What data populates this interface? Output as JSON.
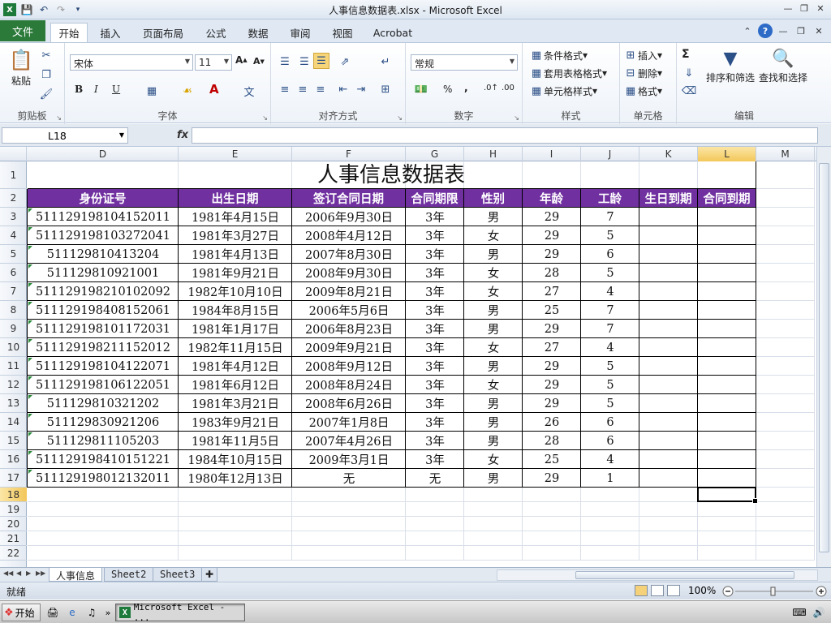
{
  "window": {
    "title": "人事信息数据表.xlsx - Microsoft Excel"
  },
  "qat": {
    "save_icon": "save-icon",
    "undo_icon": "undo-icon",
    "redo_icon": "redo-icon"
  },
  "tabs": [
    {
      "label": "文件"
    },
    {
      "label": "开始"
    },
    {
      "label": "插入"
    },
    {
      "label": "页面布局"
    },
    {
      "label": "公式"
    },
    {
      "label": "数据"
    },
    {
      "label": "审阅"
    },
    {
      "label": "视图"
    },
    {
      "label": "Acrobat"
    }
  ],
  "ribbon": {
    "clipboard": {
      "paste": "粘贴",
      "label": "剪贴板"
    },
    "font": {
      "name": "宋体",
      "size": "11",
      "bold": "B",
      "italic": "I",
      "underline": "U",
      "label": "字体"
    },
    "alignment": {
      "label": "对齐方式"
    },
    "number": {
      "format": "常规",
      "label": "数字",
      "percent": "%",
      "comma": ","
    },
    "styles": {
      "conditional": "条件格式",
      "table": "套用表格格式",
      "cell_styles": "单元格样式",
      "label": "样式"
    },
    "cells": {
      "insert": "插入",
      "delete": "删除",
      "format": "格式",
      "label": "单元格"
    },
    "editing": {
      "sort": "排序和筛选",
      "find": "查找和选择",
      "label": "编辑",
      "sigma": "Σ"
    }
  },
  "formula_bar": {
    "name_box": "L18",
    "fx": "fx",
    "value": ""
  },
  "sheet": {
    "columns": [
      "D",
      "E",
      "F",
      "G",
      "H",
      "I",
      "J",
      "K",
      "L",
      "M"
    ],
    "rows": [
      "1",
      "2",
      "3",
      "4",
      "5",
      "6",
      "7",
      "8",
      "9",
      "10",
      "11",
      "12",
      "13",
      "14",
      "15",
      "16",
      "17",
      "18",
      "19",
      "20",
      "21",
      "22"
    ],
    "selected_column": "L",
    "selected_row": "18",
    "title": "人事信息数据表",
    "headers": [
      "身份证号",
      "出生日期",
      "签订合同日期",
      "合同期限",
      "性别",
      "年龄",
      "工龄",
      "生日到期",
      "合同到期"
    ],
    "records": [
      [
        "511129198104152011",
        "1981年4月15日",
        "2006年9月30日",
        "3年",
        "男",
        "29",
        "7"
      ],
      [
        "511129198103272041",
        "1981年3月27日",
        "2008年4月12日",
        "3年",
        "女",
        "29",
        "5"
      ],
      [
        "511129810413204",
        "1981年4月13日",
        "2007年8月30日",
        "3年",
        "男",
        "29",
        "6"
      ],
      [
        "511129810921001",
        "1981年9月21日",
        "2008年9月30日",
        "3年",
        "女",
        "28",
        "5"
      ],
      [
        "511129198210102092",
        "1982年10月10日",
        "2009年8月21日",
        "3年",
        "女",
        "27",
        "4"
      ],
      [
        "511129198408152061",
        "1984年8月15日",
        "2006年5月6日",
        "3年",
        "男",
        "25",
        "7"
      ],
      [
        "511129198101172031",
        "1981年1月17日",
        "2006年8月23日",
        "3年",
        "男",
        "29",
        "7"
      ],
      [
        "511129198211152012",
        "1982年11月15日",
        "2009年9月21日",
        "3年",
        "女",
        "27",
        "4"
      ],
      [
        "511129198104122071",
        "1981年4月12日",
        "2008年9月12日",
        "3年",
        "男",
        "29",
        "5"
      ],
      [
        "511129198106122051",
        "1981年6月12日",
        "2008年8月24日",
        "3年",
        "女",
        "29",
        "5"
      ],
      [
        "511129810321202",
        "1981年3月21日",
        "2008年6月26日",
        "3年",
        "男",
        "29",
        "5"
      ],
      [
        "511129830921206",
        "1983年9月21日",
        "2007年1月8日",
        "3年",
        "男",
        "26",
        "6"
      ],
      [
        "511129811105203",
        "1981年11月5日",
        "2007年4月26日",
        "3年",
        "男",
        "28",
        "6"
      ],
      [
        "511129198410151221",
        "1984年10月15日",
        "2009年3月1日",
        "3年",
        "女",
        "25",
        "4"
      ],
      [
        "511129198012132011",
        "1980年12月13日",
        "无",
        "无",
        "男",
        "29",
        "1"
      ]
    ],
    "header_color": "#7030a0"
  },
  "sheet_tabs": [
    {
      "label": "人事信息"
    },
    {
      "label": "Sheet2"
    },
    {
      "label": "Sheet3"
    }
  ],
  "status": {
    "ready": "就绪",
    "zoom": "100%"
  },
  "taskbar": {
    "start": "开始",
    "item": "Microsoft Excel - ..."
  }
}
